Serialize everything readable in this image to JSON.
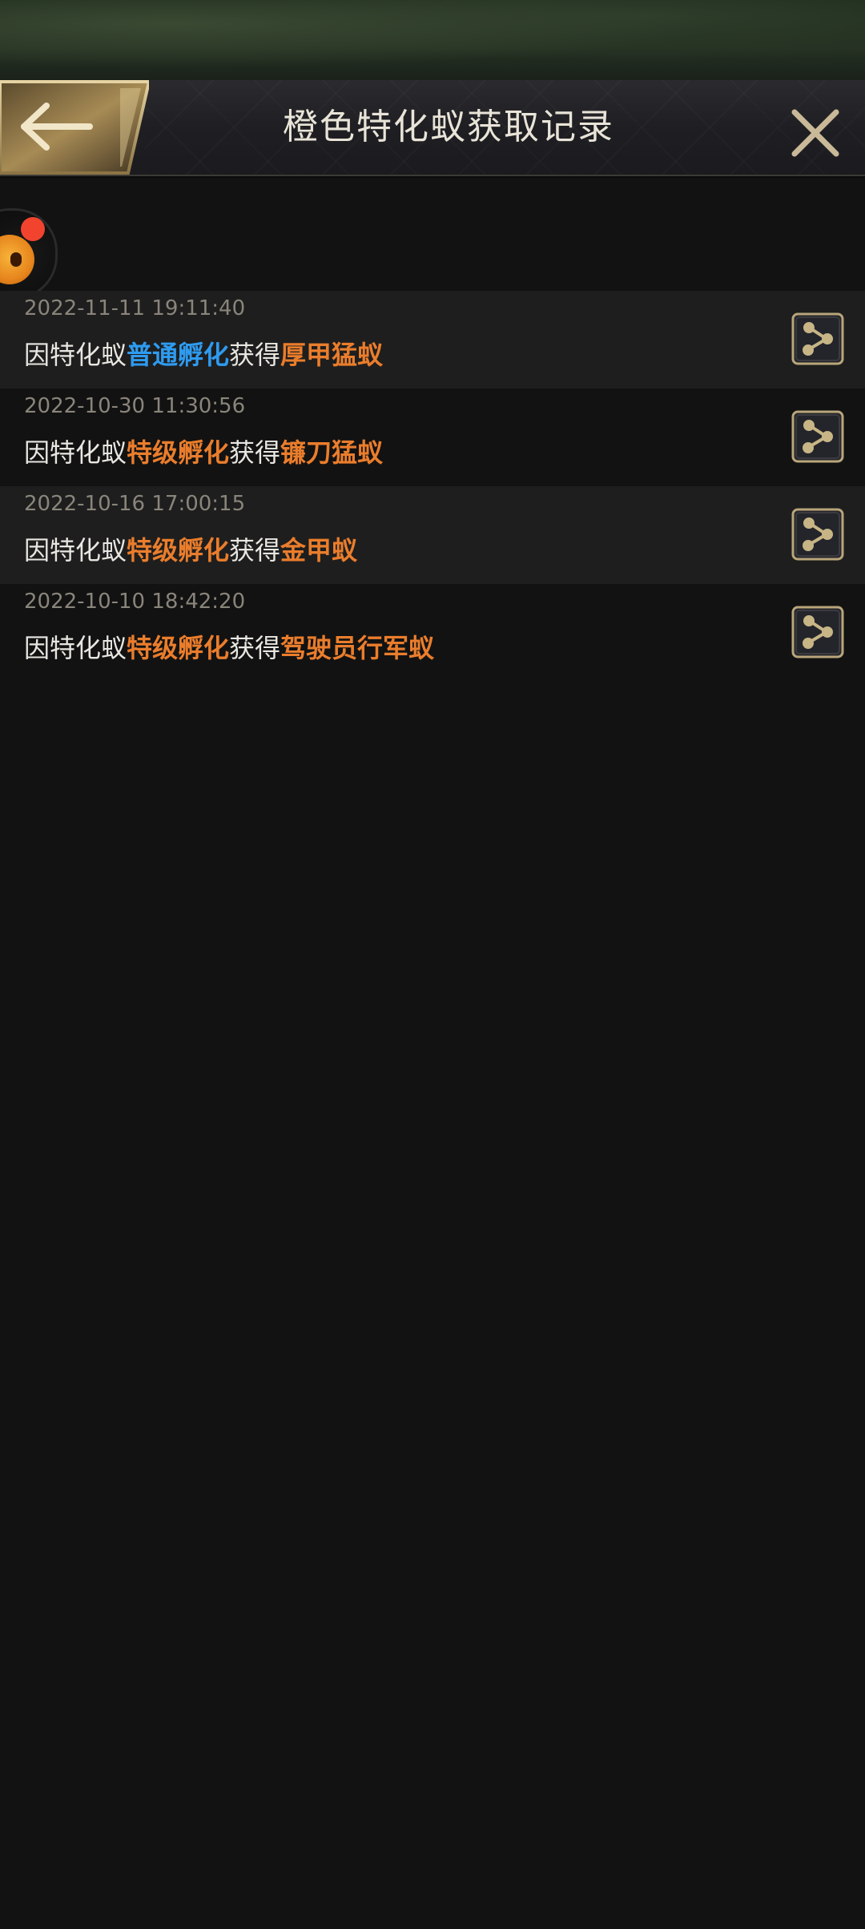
{
  "header": {
    "title": "橙色特化蚁获取记录",
    "back_icon": "arrow-left-icon",
    "close_icon": "close-icon"
  },
  "records": [
    {
      "time": "2022-11-11 19:11:40",
      "prefix": "因特化蚁",
      "method": "普通孵化",
      "method_color": "blue",
      "middle": "获得",
      "reward": "厚甲猛蚁"
    },
    {
      "time": "2022-10-30 11:30:56",
      "prefix": "因特化蚁",
      "method": "特级孵化",
      "method_color": "orange",
      "middle": "获得",
      "reward": "镰刀猛蚁"
    },
    {
      "time": "2022-10-16 17:00:15",
      "prefix": "因特化蚁",
      "method": "特级孵化",
      "method_color": "orange",
      "middle": "获得",
      "reward": "金甲蚁"
    },
    {
      "time": "2022-10-10 18:42:20",
      "prefix": "因特化蚁",
      "method": "特级孵化",
      "method_color": "orange",
      "middle": "获得",
      "reward": "驾驶员行军蚁"
    }
  ],
  "colors": {
    "background": "#121212",
    "row_alt": "#1e1e1e",
    "highlight_blue": "#2e9bf0",
    "highlight_orange": "#ea7d2c",
    "gold": "#c9b27c"
  }
}
